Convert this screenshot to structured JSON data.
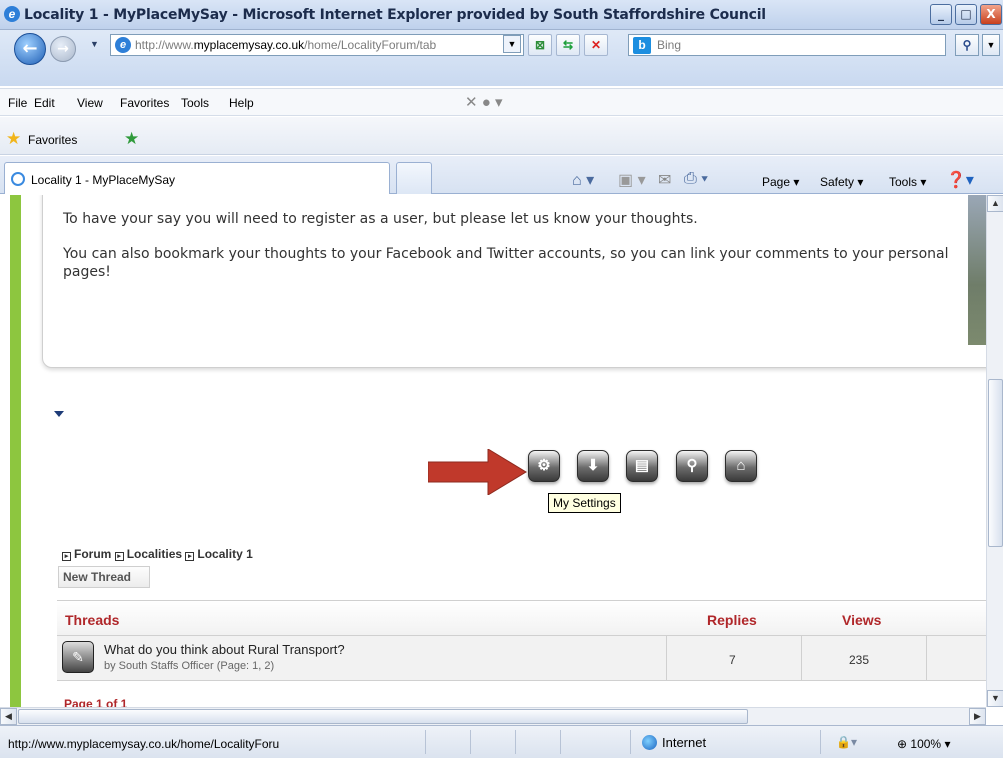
{
  "window": {
    "title": "Locality 1 - MyPlaceMySay - Microsoft Internet Explorer provided by South Staffordshire Council",
    "minimize": "_",
    "maximize": "□",
    "close": "X"
  },
  "address": {
    "url_prefix": "http://www.",
    "url_domain": "myplacemysay.co.uk",
    "url_path": "/home/LocalityForum/tab",
    "search_placeholder": "Bing"
  },
  "menu": [
    "File",
    "Edit",
    "View",
    "Favorites",
    "Tools",
    "Help"
  ],
  "favorites_bar": {
    "label": "Favorites"
  },
  "tabs": {
    "active": "Locality 1 - MyPlaceMySay"
  },
  "commandbar": [
    "Page ▾",
    "Safety ▾",
    "Tools ▾"
  ],
  "content": {
    "para1": "To have your say you will need to register as a user, but please let us know your thoughts.",
    "para2": "You can also bookmark your thoughts to your Facebook and Twitter accounts, so you can link your comments to your personal pages!",
    "tooltip": "My Settings",
    "breadcrumb": [
      "Forum",
      "Localities",
      "Locality 1"
    ],
    "new_thread": "New Thread",
    "table": {
      "headers": {
        "threads": "Threads",
        "replies": "Replies",
        "views": "Views"
      },
      "rows": [
        {
          "title": "What do you think about Rural Transport?",
          "by": "by South Staffs Officer (Page: 1, 2)",
          "replies": "7",
          "views": "235"
        }
      ]
    },
    "page_info": "Page 1 of 1"
  },
  "statusbar": {
    "url": "http://www.myplacemysay.co.uk/home/LocalityForu",
    "zone": "Internet",
    "zoom": "100%"
  },
  "colors": {
    "accent_green": "#8dc63f",
    "header_red": "#b0272a",
    "arrow_red": "#c0392b"
  }
}
